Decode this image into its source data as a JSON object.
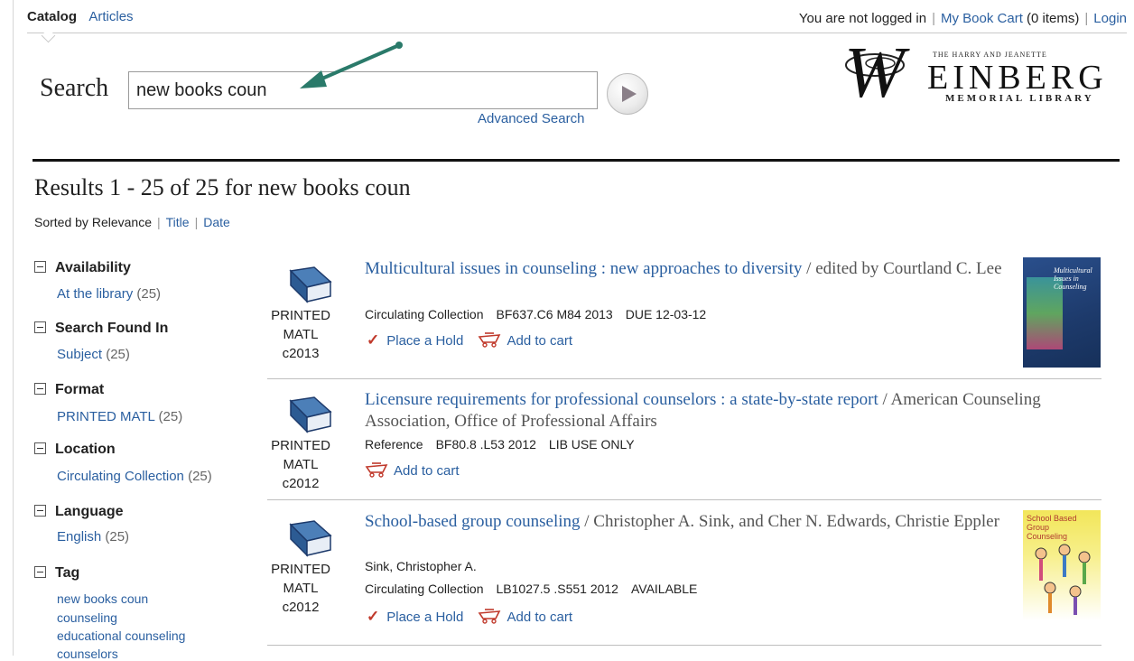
{
  "tabs": {
    "catalog": "Catalog",
    "articles": "Articles"
  },
  "userbar": {
    "not_logged_in": "You are not logged in",
    "cart_link": "My Book Cart",
    "cart_count": "(0 items)",
    "login": "Login"
  },
  "search": {
    "label": "Search",
    "value": "new books coun",
    "advanced": "Advanced Search"
  },
  "logo": {
    "letter": "W",
    "top_text": "THE HARRY AND JEANETTE",
    "name": "EINBERG",
    "subtitle": "MEMORIAL LIBRARY"
  },
  "results_heading": "Results 1 - 25 of 25 for new books coun",
  "sort": {
    "prefix": "Sorted by",
    "relevance": "Relevance",
    "title": "Title",
    "date": "Date"
  },
  "facets": [
    {
      "head": "Availability",
      "items": [
        {
          "label": "At the library",
          "count": "(25)"
        }
      ]
    },
    {
      "head": "Search Found In",
      "items": [
        {
          "label": "Subject",
          "count": "(25)"
        }
      ]
    },
    {
      "head": "Format",
      "items": [
        {
          "label": "PRINTED MATL",
          "count": "(25)"
        }
      ]
    },
    {
      "head": "Location",
      "items": [
        {
          "label": "Circulating Collection",
          "count": "(25)"
        }
      ]
    },
    {
      "head": "Language",
      "items": [
        {
          "label": "English",
          "count": "(25)"
        }
      ]
    },
    {
      "head": "Tag",
      "tags": [
        "new books coun",
        "counseling",
        "educational counseling",
        "counselors"
      ]
    }
  ],
  "results": [
    {
      "format1": "PRINTED",
      "format2": "MATL",
      "year": "c2013",
      "title": "Multicultural issues in counseling : new approaches to diversity",
      "resp": " / edited by Courtland C. Lee",
      "author_link": "",
      "collection": "Circulating Collection",
      "call": "BF637.C6 M84 2013",
      "status": "DUE 12-03-12",
      "place_hold": "Place a Hold",
      "add_cart": "Add to cart",
      "cover_text": "Multicultural Issues in Counseling"
    },
    {
      "format1": "PRINTED",
      "format2": "MATL",
      "year": "c2012",
      "title": "Licensure requirements for professional counselors : a state-by-state report",
      "resp": " / American Counseling Association, Office of Professional Affairs",
      "author_link": "",
      "collection": "Reference",
      "call": "BF80.8 .L53 2012",
      "status": "LIB USE ONLY",
      "place_hold": "",
      "add_cart": "Add to cart"
    },
    {
      "format1": "PRINTED",
      "format2": "MATL",
      "year": "c2012",
      "title": "School-based group counseling",
      "resp": " / Christopher A. Sink, and Cher N. Edwards, Christie Eppler",
      "author_link": "Sink, Christopher A.",
      "collection": "Circulating Collection",
      "call": "LB1027.5 .S551 2012",
      "status": "AVAILABLE",
      "place_hold": "Place a Hold",
      "add_cart": "Add to cart",
      "cover_text": "School Based Group Counseling"
    }
  ],
  "colors": {
    "link": "#2a5fa0",
    "arrow": "#2a7a6a",
    "check": "#c0392b",
    "cover1": "#1d3a6b",
    "cover2": "#f2e65a"
  }
}
